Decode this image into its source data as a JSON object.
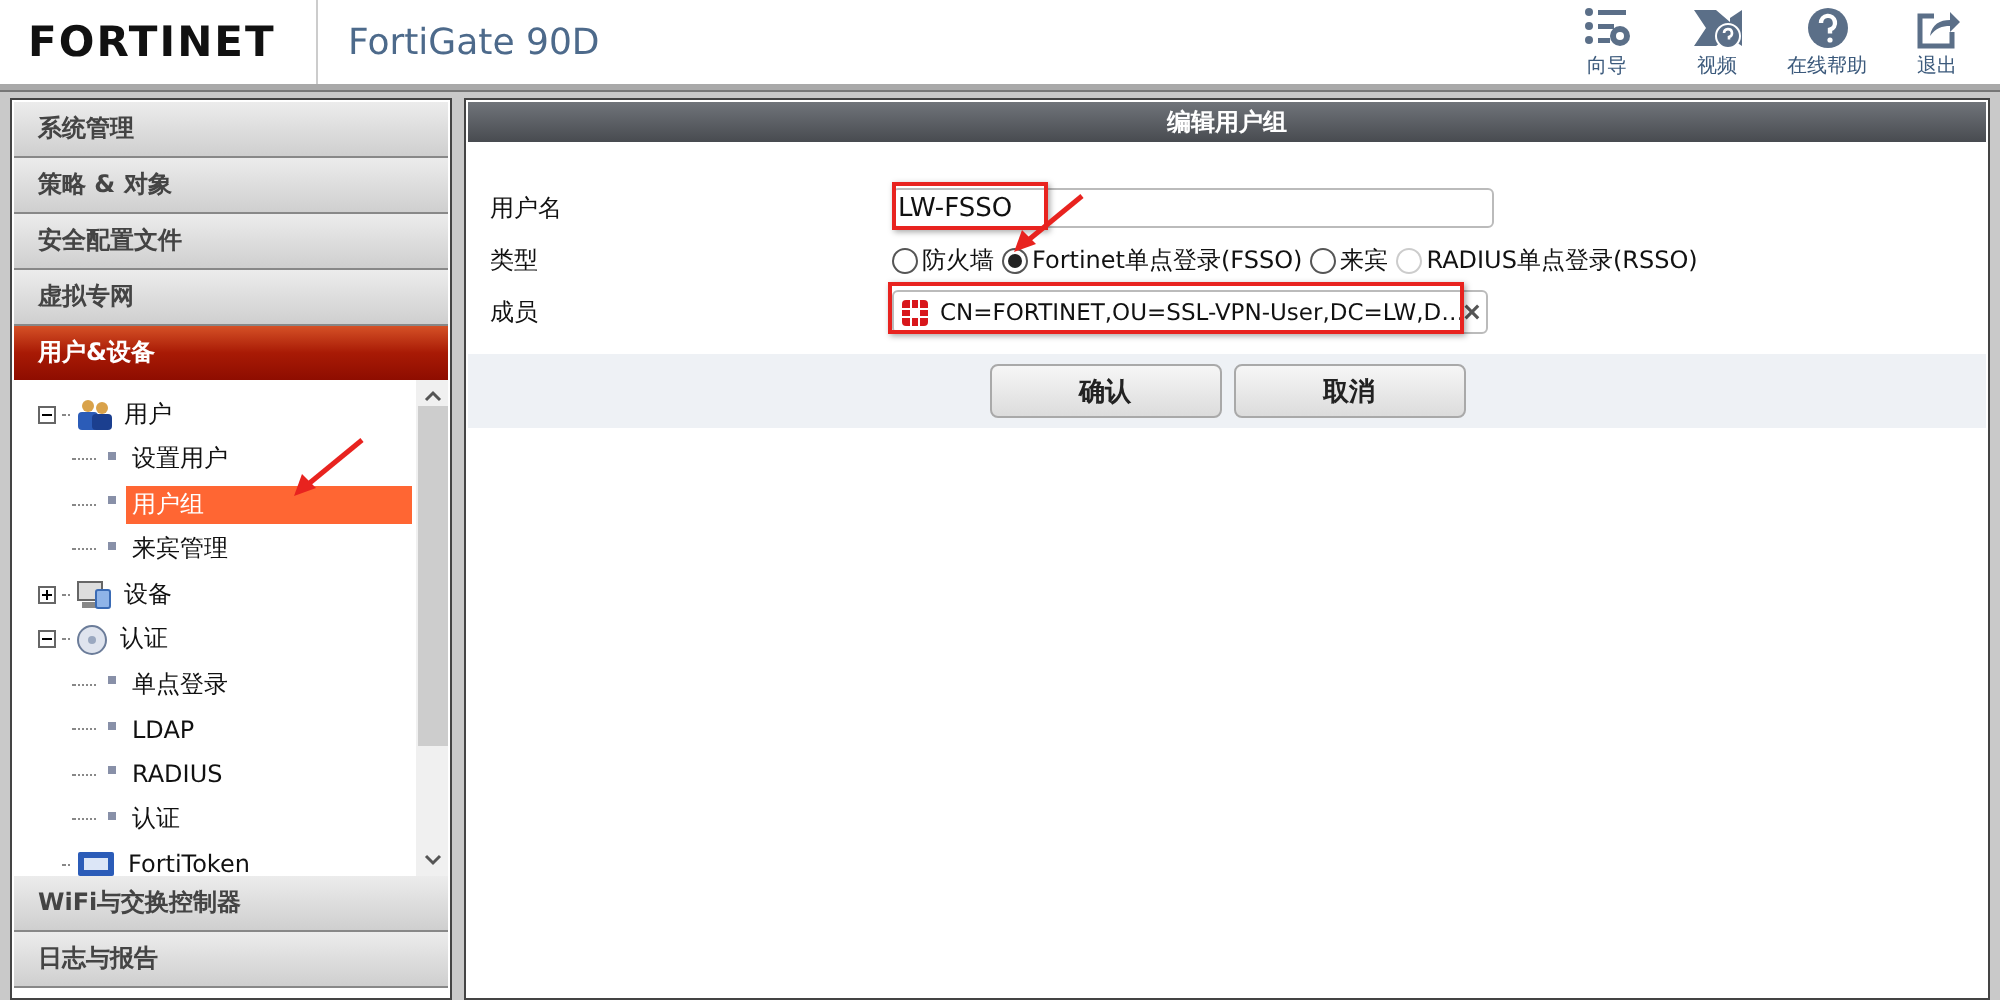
{
  "header": {
    "logo": "FORTINET",
    "device": "FortiGate 90D",
    "tools": [
      {
        "kind": "wizard",
        "label": "向导"
      },
      {
        "kind": "video",
        "label": "视频"
      },
      {
        "kind": "help",
        "label": "在线帮助"
      },
      {
        "kind": "logout",
        "label": "退出"
      }
    ]
  },
  "sidebar": {
    "sections": [
      {
        "label": "系统管理",
        "selected": false
      },
      {
        "label": "策略 & 对象",
        "selected": false
      },
      {
        "label": "安全配置文件",
        "selected": false
      },
      {
        "label": "虚拟专网",
        "selected": false
      },
      {
        "label": "用户&设备",
        "selected": true,
        "tree": [
          {
            "kind": "users",
            "label": "用户",
            "expanded": true,
            "selected": false,
            "children": [
              {
                "label": "设置用户",
                "selected": false,
                "annotated": false
              },
              {
                "label": "用户组",
                "selected": true,
                "annotated": true
              },
              {
                "label": "来宾管理",
                "selected": false,
                "annotated": false
              }
            ]
          },
          {
            "kind": "devices",
            "label": "设备",
            "expanded": false,
            "selected": false
          },
          {
            "kind": "auth",
            "label": "认证",
            "expanded": true,
            "selected": false,
            "children": [
              {
                "label": "单点登录",
                "selected": false,
                "annotated": false
              },
              {
                "label": "LDAP",
                "selected": false,
                "annotated": false
              },
              {
                "label": "RADIUS",
                "selected": false,
                "annotated": false
              },
              {
                "label": "认证",
                "selected": false,
                "annotated": false
              }
            ]
          },
          {
            "kind": "token",
            "label": "FortiToken",
            "selected": false
          }
        ]
      },
      {
        "label": "WiFi与交换控制器",
        "selected": false
      },
      {
        "label": "日志与报告",
        "selected": false
      }
    ]
  },
  "form": {
    "title": "编辑用户组",
    "fields": [
      {
        "kind": "text",
        "label": "用户名",
        "value": "LW-FSSO",
        "annotated": true
      },
      {
        "kind": "radio",
        "label": "类型",
        "options": [
          {
            "label": "防火墙",
            "selected": false,
            "disabled": false,
            "annotated": false
          },
          {
            "label": "Fortinet单点登录(FSSO)",
            "selected": true,
            "disabled": false,
            "annotated": true
          },
          {
            "label": "来宾",
            "selected": false,
            "disabled": false,
            "annotated": false
          },
          {
            "label": "RADIUS单点登录(RSSO)",
            "selected": false,
            "disabled": true,
            "annotated": false
          }
        ]
      },
      {
        "kind": "members",
        "label": "成员",
        "annotated": true,
        "members": [
          {
            "label": "CN=FORTINET,OU=SSL-VPN-User,DC=LW,D…"
          }
        ]
      }
    ],
    "buttons": [
      "确认",
      "取消"
    ]
  }
}
